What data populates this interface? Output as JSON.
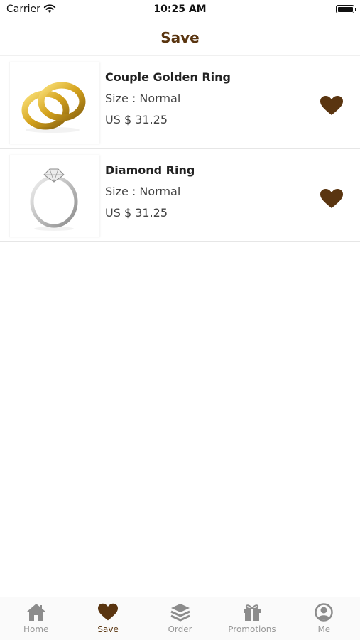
{
  "status": {
    "carrier": "Carrier",
    "time": "10:25 AM"
  },
  "header": {
    "title": "Save"
  },
  "items": [
    {
      "name": "Couple Golden Ring",
      "size": "Size : Normal",
      "price": "US $ 31.25"
    },
    {
      "name": "Diamond Ring",
      "size": "Size : Normal",
      "price": "US $ 31.25"
    }
  ],
  "tabs": [
    {
      "label": "Home",
      "icon": "home-icon"
    },
    {
      "label": "Save",
      "icon": "heart-icon",
      "active": true
    },
    {
      "label": "Order",
      "icon": "layers-icon"
    },
    {
      "label": "Promotions",
      "icon": "gift-icon"
    },
    {
      "label": "Me",
      "icon": "user-icon"
    }
  ],
  "colors": {
    "accent": "#5a3510",
    "inactive": "#8c8c8c"
  }
}
